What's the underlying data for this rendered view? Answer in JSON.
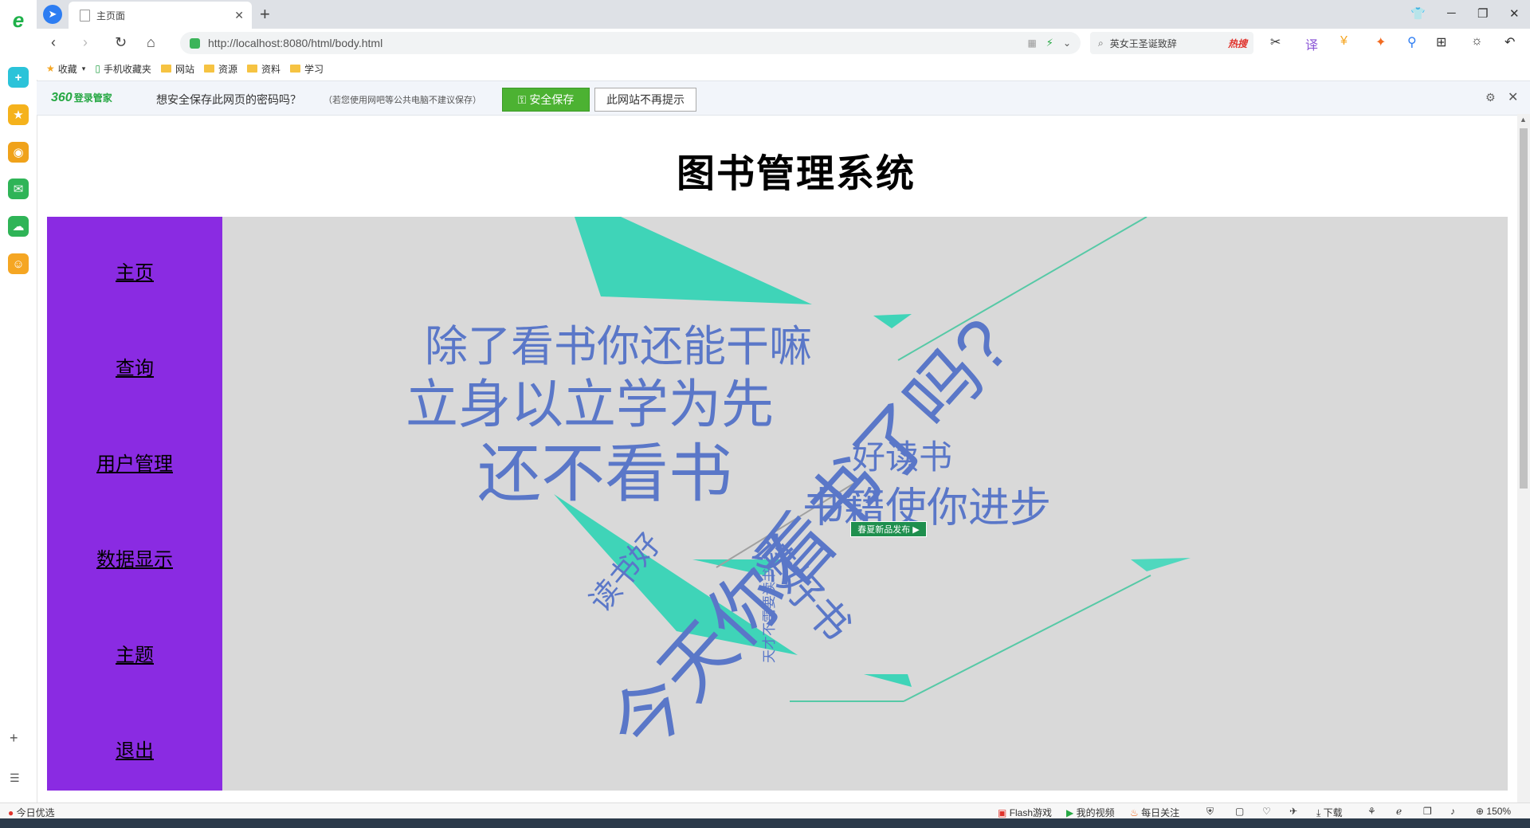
{
  "browser": {
    "tab_title": "主页面",
    "address": "http://localhost:8080/html/body.html",
    "search_query": "英女王圣诞致辞",
    "search_hot": "热搜"
  },
  "bookmarks": [
    "收藏",
    "手机收藏夹",
    "网站",
    "资源",
    "资料",
    "学习"
  ],
  "password_bar": {
    "logo": "360",
    "logo_sub": "登录管家",
    "message": "想安全保存此网页的密码吗？",
    "note": "（若您使用网吧等公共电脑不建议保存）",
    "save_label": "安全保存",
    "never_label": "此网站不再提示"
  },
  "page": {
    "title": "图书管理系统",
    "menu": [
      "主页",
      "查询",
      "用户管理",
      "数据显示",
      "主题",
      "退出"
    ]
  },
  "wordcloud": {
    "color": "#5a77c8",
    "words": [
      "除了看书你还能干嘛",
      "立身以立学为先",
      "还不看书",
      "今天你看书了吗?",
      "好读书",
      "书籍使你进步",
      "读书好",
      "读好书",
      "天才不需要读书"
    ],
    "promo": "春夏新品发布 ▶"
  },
  "statusbar": {
    "left": "今日优选",
    "items": [
      "Flash游戏",
      "我的视频",
      "每日关注",
      "下载"
    ],
    "zoom": "150%"
  },
  "colors": {
    "sidebar_bg": "#8a2be2",
    "content_bg": "#d9d9d9",
    "accent_green": "#4cb232",
    "teal_shape": "#3fd4b8"
  }
}
